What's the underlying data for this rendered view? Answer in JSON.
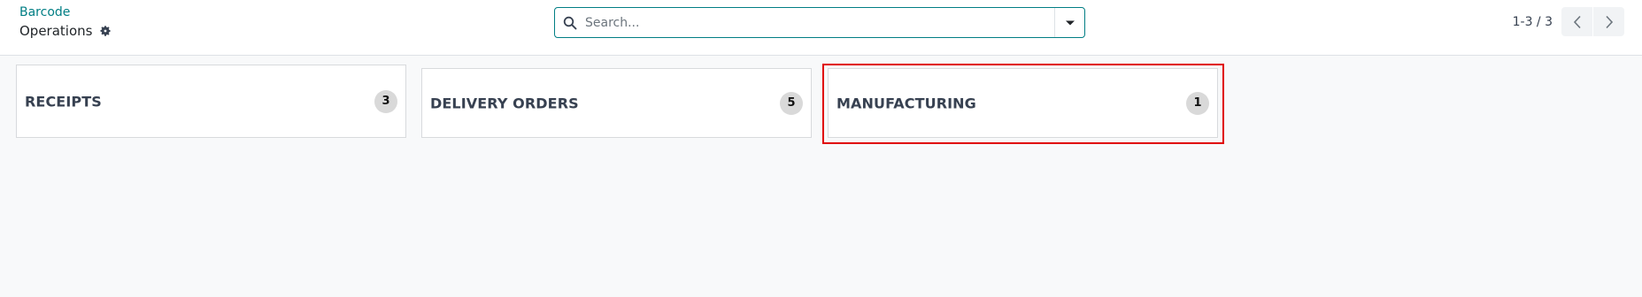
{
  "breadcrumb": {
    "parent": "Barcode",
    "current": "Operations"
  },
  "search": {
    "value": "",
    "placeholder": "Search..."
  },
  "pager": {
    "value": "1-3 / 3"
  },
  "icons": {
    "gear": "gear-icon",
    "search": "search-icon",
    "filter_toggle": "caret-down-icon",
    "prev": "chevron-left-icon",
    "next": "chevron-right-icon"
  },
  "cards": [
    {
      "title": "RECEIPTS",
      "count": "3"
    },
    {
      "title": "DELIVERY ORDERS",
      "count": "5"
    },
    {
      "title": "MANUFACTURING",
      "count": "1",
      "highlighted": true
    }
  ],
  "colors": {
    "accent": "#017e84",
    "highlight": "#e00000",
    "badge": "#d9d9d9",
    "background": "#f8f9fa"
  }
}
